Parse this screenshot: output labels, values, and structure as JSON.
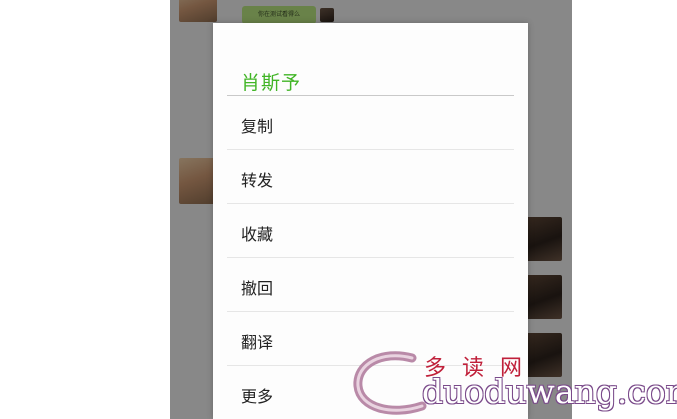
{
  "background_chat": {
    "mini_bubble_text": "你在测试看得么"
  },
  "dialog": {
    "title": "肖斯予",
    "title_color": "#41b526",
    "items": [
      {
        "label": "复制"
      },
      {
        "label": "转发"
      },
      {
        "label": "收藏"
      },
      {
        "label": "撤回"
      },
      {
        "label": "翻译"
      },
      {
        "label": "更多"
      }
    ]
  },
  "watermark": {
    "chinese": "多读网",
    "url": "duoduwang.com"
  }
}
